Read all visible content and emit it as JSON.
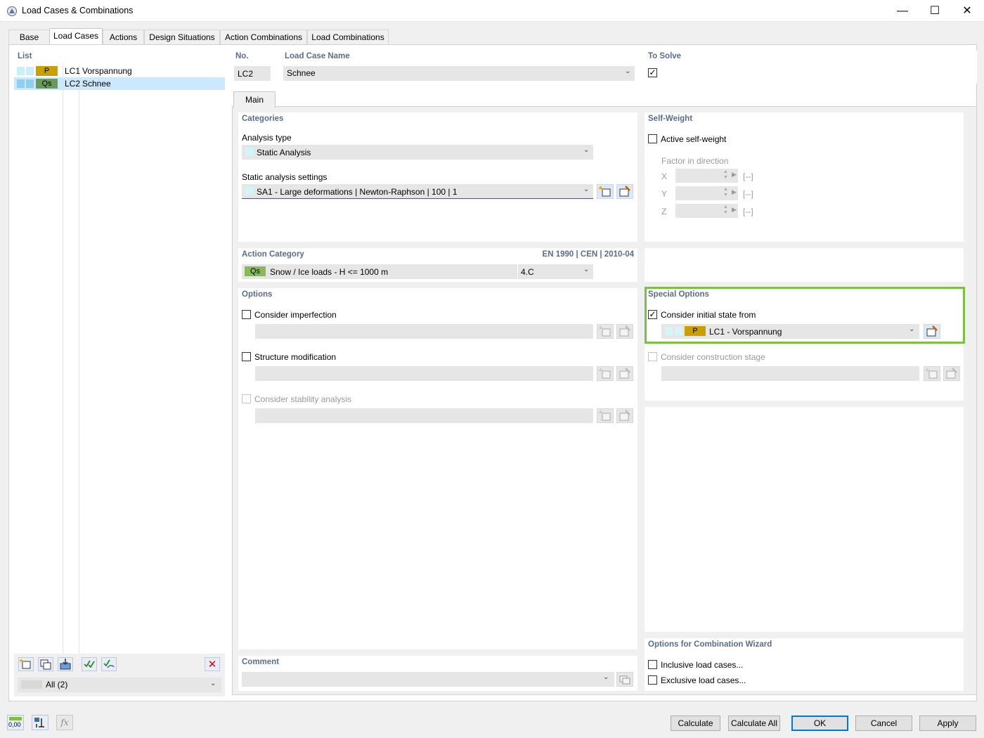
{
  "window": {
    "title": "Load Cases & Combinations",
    "controls": {
      "minimize": "—",
      "maximize": "☐",
      "close": "✕"
    }
  },
  "tabs": [
    "Base",
    "Load Cases",
    "Actions",
    "Design Situations",
    "Action Combinations",
    "Load Combinations"
  ],
  "active_tab": "Load Cases",
  "list": {
    "title": "List",
    "items": [
      {
        "badge": "P",
        "badge_color": "#c8a000",
        "no": "LC1",
        "name": "Vorspannung",
        "selected": false
      },
      {
        "badge": "Qs",
        "badge_color": "#6a9a5a",
        "no": "LC2",
        "name": "Schnee",
        "selected": true
      }
    ],
    "filter_value": "All (2)"
  },
  "header": {
    "no_label": "No.",
    "no_value": "LC2",
    "name_label": "Load Case Name",
    "name_value": "Schnee",
    "to_solve_label": "To Solve",
    "to_solve_checked": true
  },
  "subtab": "Main",
  "categories": {
    "title": "Categories",
    "analysis_type_label": "Analysis type",
    "analysis_type_value": "Static Analysis",
    "static_settings_label": "Static analysis settings",
    "static_settings_value": "SA1 - Large deformations | Newton-Raphson | 100 | 1"
  },
  "self_weight": {
    "title": "Self-Weight",
    "active_label": "Active self-weight",
    "factor_label": "Factor in direction",
    "axes": [
      "X",
      "Y",
      "Z"
    ],
    "unit": "[--]"
  },
  "action_category": {
    "title": "Action Category",
    "norm": "EN 1990 | CEN | 2010-04",
    "badge": "Qs",
    "value": "Snow / Ice loads - H <= 1000 m",
    "code": "4.C"
  },
  "options": {
    "title": "Options",
    "imperfection_label": "Consider imperfection",
    "structure_mod_label": "Structure modification",
    "stability_label": "Consider stability analysis"
  },
  "special_options": {
    "title": "Special Options",
    "initial_state_label": "Consider initial state from",
    "initial_state_checked": true,
    "initial_state_badge": "P",
    "initial_state_value": "LC1 - Vorspannung",
    "construction_stage_label": "Consider construction stage"
  },
  "comment": {
    "title": "Comment",
    "value": ""
  },
  "wizard": {
    "title": "Options for Combination Wizard",
    "inclusive_label": "Inclusive load cases...",
    "exclusive_label": "Exclusive load cases..."
  },
  "buttons": {
    "calculate": "Calculate",
    "calculate_all": "Calculate All",
    "ok": "OK",
    "cancel": "Cancel",
    "apply": "Apply"
  },
  "footer_icon_text": "0,00",
  "colors": {
    "accent_title": "#5b6d8c",
    "highlight_border": "#7cc242",
    "selection": "#cce8ff",
    "badge_p": "#c8a000",
    "badge_qs": "#6a9a5a"
  }
}
